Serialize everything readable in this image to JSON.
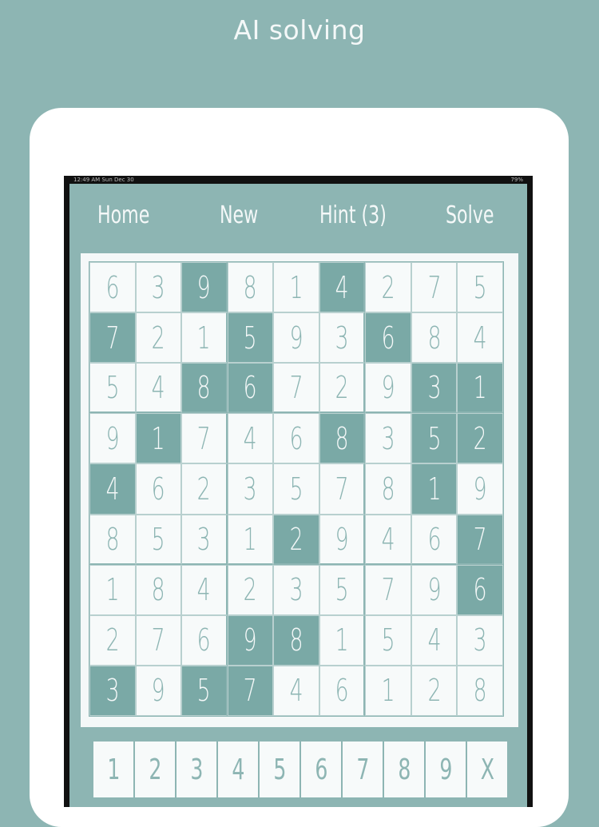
{
  "headline": "AI solving",
  "status_bar": {
    "time": "12:49 AM  Sun Dec 30",
    "right": "79%"
  },
  "nav": {
    "home": "Home",
    "new": "New",
    "hint": "Hint (3)",
    "solve": "Solve"
  },
  "colors": {
    "background": "#8db5b3",
    "given_cell": "#7aa9a6",
    "cell": "#f7fafa",
    "digit": "#8db5b3"
  },
  "grid": [
    [
      "6",
      "3",
      "9",
      "8",
      "1",
      "4",
      "2",
      "7",
      "5"
    ],
    [
      "7",
      "2",
      "1",
      "5",
      "9",
      "3",
      "6",
      "8",
      "4"
    ],
    [
      "5",
      "4",
      "8",
      "6",
      "7",
      "2",
      "9",
      "3",
      "1"
    ],
    [
      "9",
      "1",
      "7",
      "4",
      "6",
      "8",
      "3",
      "5",
      "2"
    ],
    [
      "4",
      "6",
      "2",
      "3",
      "5",
      "7",
      "8",
      "1",
      "9"
    ],
    [
      "8",
      "5",
      "3",
      "1",
      "2",
      "9",
      "4",
      "6",
      "7"
    ],
    [
      "1",
      "8",
      "4",
      "2",
      "3",
      "5",
      "7",
      "9",
      "6"
    ],
    [
      "2",
      "7",
      "6",
      "9",
      "8",
      "1",
      "5",
      "4",
      "3"
    ],
    [
      "3",
      "9",
      "5",
      "7",
      "4",
      "6",
      "1",
      "2",
      "8"
    ]
  ],
  "given": [
    [
      0,
      0,
      1,
      0,
      0,
      1,
      0,
      0,
      0
    ],
    [
      1,
      0,
      0,
      1,
      0,
      0,
      1,
      0,
      0
    ],
    [
      0,
      0,
      1,
      1,
      0,
      0,
      0,
      1,
      1
    ],
    [
      0,
      1,
      0,
      0,
      0,
      1,
      0,
      1,
      1
    ],
    [
      1,
      0,
      0,
      0,
      0,
      0,
      0,
      1,
      0
    ],
    [
      0,
      0,
      0,
      0,
      1,
      0,
      0,
      0,
      1
    ],
    [
      0,
      0,
      0,
      0,
      0,
      0,
      0,
      0,
      1
    ],
    [
      0,
      0,
      0,
      1,
      1,
      0,
      0,
      0,
      0
    ],
    [
      1,
      0,
      1,
      1,
      0,
      0,
      0,
      0,
      0
    ]
  ],
  "keypad": [
    "1",
    "2",
    "3",
    "4",
    "5",
    "6",
    "7",
    "8",
    "9",
    "X"
  ]
}
